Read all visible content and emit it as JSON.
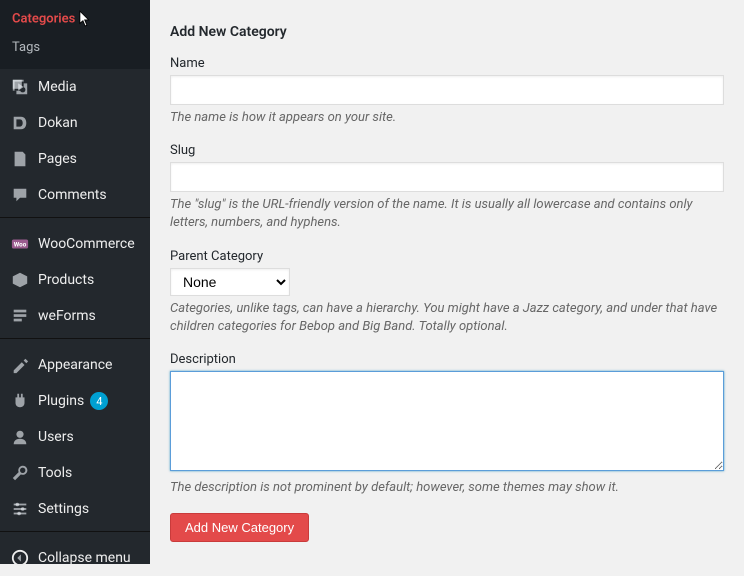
{
  "submenu": {
    "categories": "Categories",
    "tags": "Tags"
  },
  "sidebar": {
    "items": [
      {
        "label": "Media",
        "name": "media"
      },
      {
        "label": "Dokan",
        "name": "dokan"
      },
      {
        "label": "Pages",
        "name": "pages"
      },
      {
        "label": "Comments",
        "name": "comments"
      },
      {
        "label": "WooCommerce",
        "name": "woocommerce"
      },
      {
        "label": "Products",
        "name": "products"
      },
      {
        "label": "weForms",
        "name": "weforms"
      },
      {
        "label": "Appearance",
        "name": "appearance"
      },
      {
        "label": "Plugins",
        "name": "plugins",
        "badge": "4"
      },
      {
        "label": "Users",
        "name": "users"
      },
      {
        "label": "Tools",
        "name": "tools"
      },
      {
        "label": "Settings",
        "name": "settings"
      },
      {
        "label": "Collapse menu",
        "name": "collapse"
      }
    ]
  },
  "form": {
    "title": "Add New Category",
    "name_label": "Name",
    "name_value": "",
    "name_help": "The name is how it appears on your site.",
    "slug_label": "Slug",
    "slug_value": "",
    "slug_help": "The \"slug\" is the URL-friendly version of the name. It is usually all lowercase and contains only letters, numbers, and hyphens.",
    "parent_label": "Parent Category",
    "parent_selected": "None",
    "parent_help": "Categories, unlike tags, can have a hierarchy. You might have a Jazz category, and under that have children categories for Bebop and Big Band. Totally optional.",
    "desc_label": "Description",
    "desc_value": "",
    "desc_help": "The description is not prominent by default; however, some themes may show it.",
    "submit_label": "Add New Category"
  }
}
